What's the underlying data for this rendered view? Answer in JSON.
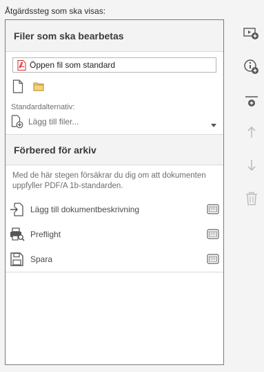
{
  "header": {
    "title": "Åtgärdssteg som ska visas:"
  },
  "files_section": {
    "title": "Filer som ska bearbetas",
    "selected_file": "Öppen fil som standard",
    "default_options_label": "Standardalternativ:",
    "add_files_label": "Lägg till filer..."
  },
  "archive_section": {
    "title": "Förbered för arkiv",
    "description": "Med de här stegen försäkrar du dig om att dokumenten uppfyller PDF/A 1b-standarden.",
    "steps": [
      {
        "label": "Lägg till dokumentbeskrivning",
        "icon": "add-doc-description-icon"
      },
      {
        "label": "Preflight",
        "icon": "preflight-icon"
      },
      {
        "label": "Spara",
        "icon": "save-icon"
      }
    ]
  },
  "toolbar": {
    "buttons": [
      "add-tool-icon",
      "add-instruction-icon",
      "add-panel-divider-icon",
      "move-up-icon",
      "move-down-icon",
      "delete-icon"
    ]
  },
  "colors": {
    "pdf_red": "#d7272b",
    "folder_yellow": "#e8c25a",
    "icon_gray": "#555555",
    "disabled_gray": "#bdbdbd"
  }
}
